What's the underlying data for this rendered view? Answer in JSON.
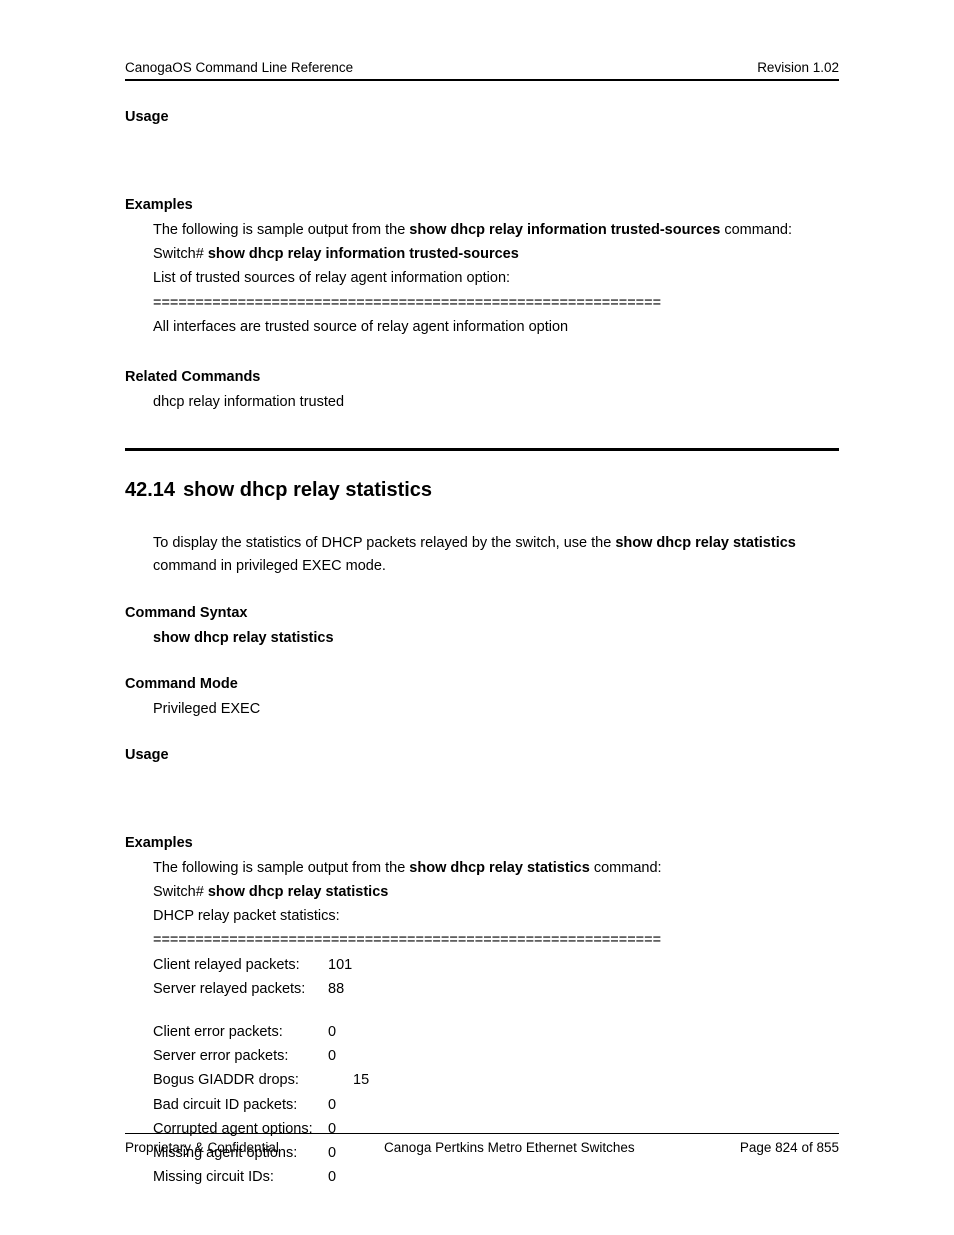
{
  "header": {
    "left": "CanogaOS Command Line Reference",
    "right": "Revision 1.02"
  },
  "sec1": {
    "usage_h": "Usage",
    "examples_h": "Examples",
    "ex_intro_pre": "The following is sample output from the ",
    "ex_intro_cmd": "show dhcp relay information trusted-sources",
    "ex_intro_post": " command:",
    "prompt": "Switch# ",
    "prompt_cmd": "show dhcp relay information trusted-sources",
    "line1": "List of trusted sources of relay agent information option:",
    "divider": "============================================================",
    "line2": "All interfaces are trusted source of relay agent information option",
    "related_h": "Related Commands",
    "related_body": "dhcp relay information trusted"
  },
  "chapter": {
    "num": "42.14",
    "title": "show dhcp relay statistics",
    "desc_pre": "To display the statistics of DHCP packets relayed by the switch, use the ",
    "desc_cmd": "show dhcp relay statistics",
    "desc_post": " command in privileged EXEC mode.",
    "syntax_h": "Command Syntax",
    "syntax_body": "show dhcp relay statistics",
    "mode_h": "Command Mode",
    "mode_body": "Privileged EXEC",
    "usage_h": "Usage",
    "examples_h": "Examples",
    "ex_intro_pre": "The following is sample output from the ",
    "ex_intro_cmd": "show dhcp relay statistics",
    "ex_intro_post": " command:",
    "prompt": "Switch# ",
    "prompt_cmd": "show dhcp relay statistics",
    "out_title": "DHCP relay packet statistics:",
    "out_div": "============================================================",
    "stats": [
      {
        "label": "Client relayed packets:",
        "value": "101"
      },
      {
        "label": "Server relayed packets:",
        "value": "88"
      }
    ],
    "stats2": [
      {
        "label": "Client error packets:",
        "value": "0"
      },
      {
        "label": "Server error packets:",
        "value": "0"
      },
      {
        "label": "Bogus GIADDR drops:",
        "value": "15"
      },
      {
        "label": "Bad circuit ID packets:",
        "value": "0"
      },
      {
        "label": "Corrupted agent options:",
        "value": "0"
      },
      {
        "label": "Missing agent options:",
        "value": "0"
      },
      {
        "label": "Missing circuit IDs:",
        "value": "0"
      }
    ]
  },
  "footer": {
    "left": "Proprietary & Confidential",
    "center": "Canoga Pertkins Metro Ethernet Switches",
    "right": "Page 824 of 855"
  }
}
